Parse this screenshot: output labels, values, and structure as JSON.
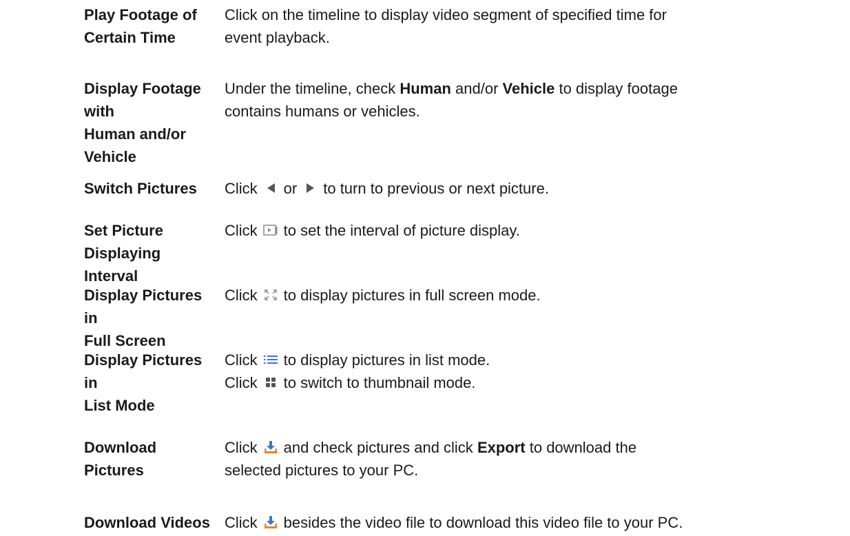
{
  "rows": [
    {
      "term": [
        "Play Footage of",
        "Certain Time"
      ],
      "desc": [
        "Click on the timeline to display video segment of specified time for",
        "event playback."
      ]
    },
    {
      "term": [
        "Display Footage with",
        "Human and/or",
        "Vehicle"
      ],
      "desc_a": "Under the timeline, check ",
      "desc_b": "Human",
      "desc_c": " and/or ",
      "desc_d": "Vehicle",
      "desc_e": " to display footage",
      "desc_2": "contains humans or vehicles."
    },
    {
      "term": [
        "Switch Pictures"
      ],
      "desc_a": "Click",
      "desc_b": "or",
      "desc_c": "to turn to previous or next picture."
    },
    {
      "term": [
        "Set Picture",
        "Displaying Interval"
      ],
      "desc_a": "Click",
      "desc_b": "to set the interval of picture display."
    },
    {
      "term": [
        "Display Pictures in",
        "Full Screen"
      ],
      "desc_a": "Click",
      "desc_b": "to display pictures in full screen mode."
    },
    {
      "term": [
        "Display Pictures in",
        "List Mode"
      ],
      "desc_1a": "Click",
      "desc_1b": "to display pictures in list mode.",
      "desc_2a": "Click",
      "desc_2b": "to switch to thumbnail mode."
    },
    {
      "term": [
        "Download Pictures"
      ],
      "desc_a": "Click",
      "desc_b": "and check pictures and click ",
      "desc_c": "Export",
      "desc_d": " to download the",
      "desc_2": "selected pictures to your PC."
    },
    {
      "term": [
        "Download Videos"
      ],
      "desc_a": "Click",
      "desc_b": "besides the video file to download this video file to your PC."
    }
  ],
  "icons": {
    "previous": "triangle-left-icon",
    "next": "triangle-right-icon",
    "interval": "slideshow-icon",
    "fullscreen": "fullscreen-icon",
    "list": "list-icon",
    "thumbnail": "grid-icon",
    "download": "download-icon"
  },
  "colors": {
    "text": "#1a1a1a",
    "icon_gray": "#555555",
    "icon_light": "#8a8a8a",
    "icon_blue": "#3a78c8",
    "icon_orange": "#e8862a"
  }
}
